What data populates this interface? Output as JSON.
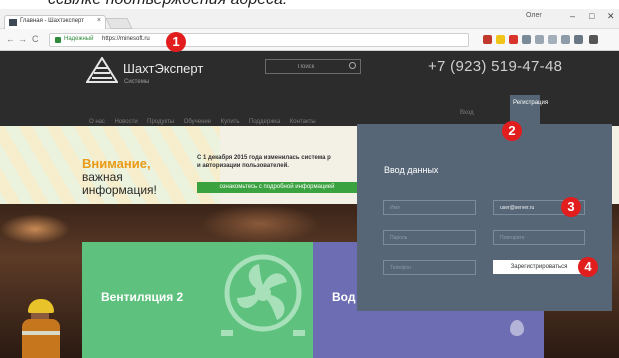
{
  "caption": {
    "text": "ссылке подтверждения адреса."
  },
  "browser": {
    "tab_title": "Главная - Шахтэксперт",
    "tab_close": "×",
    "profile": "Олег",
    "win_min": "–",
    "win_max": "□",
    "win_close": "✕",
    "back": "←",
    "forward": "→",
    "reload": "C",
    "secure_label": "Надежный",
    "url": "https://minesoft.ru"
  },
  "site": {
    "brand_name": "ШахтЭксперт",
    "brand_sub": "Системы",
    "search_placeholder": "Поиск",
    "phone": "+7 (923) 519-47-48",
    "menu": [
      "О нас",
      "Новости",
      "Продукты",
      "Обучение",
      "Купить",
      "Поддержка",
      "Контакты"
    ],
    "login_label": "Вход",
    "register_tab": "Регистрация"
  },
  "banner": {
    "warning_line1": "Внимание,",
    "warning_line2": "важная",
    "warning_line3": "информация!",
    "notice_line1": "С 1 декабря 2015 года изменилась система р",
    "notice_line2": "и авторизации пользователей.",
    "notice_link": "ознакомьтесь с подробной информацией"
  },
  "tiles": {
    "ventilation": "Вентиляция 2",
    "water": "Водо"
  },
  "form": {
    "title": "Ввод данных",
    "field1_placeholder": "Имя",
    "field2_value": "user@server.ru",
    "field3_placeholder": "Пароль",
    "field4_placeholder": "Повторите",
    "field5_placeholder": "Телефон",
    "submit_label": "Зарегистрироваться"
  },
  "markers": [
    "1",
    "2",
    "3",
    "4"
  ],
  "colors": {
    "header_bg": "#2c2c2c",
    "panel_bg": "#566676",
    "accent_green": "#3aa23f",
    "warning_orange": "#e99a16",
    "tile_green": "#5ec27e",
    "tile_purple": "#6c6db3",
    "marker_red": "#e21d1d"
  }
}
